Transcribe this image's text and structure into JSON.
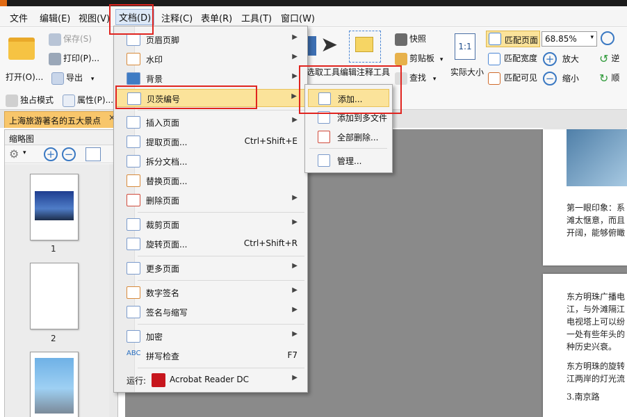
{
  "menubar": {
    "items": [
      "文件",
      "编辑(E)",
      "视图(V)",
      "文档(D)",
      "注释(C)",
      "表单(R)",
      "工具(T)",
      "窗口(W)"
    ]
  },
  "ribbon": {
    "open": "打开(O)...",
    "save": "保存(S)",
    "print": "打印(P)...",
    "export": "导出",
    "exclusive_mode": "独占模式",
    "properties": "属性(P)...",
    "select_tool": "选取工具",
    "edit_annotation_tool": "编辑注释工具",
    "snapshot": "快照",
    "clipboard": "剪贴板",
    "find": "查找",
    "actual_size": "实际大小",
    "fit_page": "匹配页面",
    "fit_width": "匹配宽度",
    "fit_visible": "匹配可见",
    "zoom_value": "68.85%",
    "zoom_in": "放大",
    "zoom_out": "缩小",
    "rotate_ccw": "逆",
    "rotate_cw": "顺"
  },
  "doc_tab": {
    "title": "上海旅游著名的五大景点",
    "close": "×"
  },
  "left_panel": {
    "title": "缩略图",
    "thumb_labels": [
      "1",
      "2"
    ]
  },
  "document_menu": {
    "items": [
      {
        "label": "页眉页脚",
        "shortcut": "",
        "submenu": true
      },
      {
        "label": "水印",
        "shortcut": "",
        "submenu": true
      },
      {
        "label": "背景",
        "shortcut": "",
        "submenu": true
      },
      {
        "label": "贝茨编号",
        "shortcut": "",
        "submenu": true
      },
      {
        "label": "插入页面",
        "shortcut": "",
        "submenu": true
      },
      {
        "label": "提取页面...",
        "shortcut": "Ctrl+Shift+E",
        "submenu": false
      },
      {
        "label": "拆分文档...",
        "shortcut": "",
        "submenu": false
      },
      {
        "label": "替换页面...",
        "shortcut": "",
        "submenu": false
      },
      {
        "label": "删除页面",
        "shortcut": "",
        "submenu": true
      },
      {
        "label": "裁剪页面",
        "shortcut": "",
        "submenu": true
      },
      {
        "label": "旋转页面...",
        "shortcut": "Ctrl+Shift+R",
        "submenu": false
      },
      {
        "label": "更多页面",
        "shortcut": "",
        "submenu": true
      },
      {
        "label": "数字签名",
        "shortcut": "",
        "submenu": true
      },
      {
        "label": "签名与缩写",
        "shortcut": "",
        "submenu": true
      },
      {
        "label": "加密",
        "shortcut": "",
        "submenu": true
      },
      {
        "label": "拼写检查",
        "shortcut": "F7",
        "submenu": false
      },
      {
        "label": "运行:",
        "app": "Acrobat Reader DC",
        "shortcut": "",
        "submenu": true
      }
    ]
  },
  "bates_submenu": {
    "items": [
      "添加...",
      "添加到多文件",
      "全部删除...",
      "管理..."
    ]
  },
  "doc_page": {
    "p1_lines": [
      "第一眼印象：系",
      "滩太惬意，而且",
      "开阔，能够俯瞰"
    ],
    "p2_lines": [
      "东方明珠广播电",
      "江，与外滩隔江",
      "电视塔上可以纷",
      "一处有些年头的",
      "种历史兴衰。",
      "东方明珠的旋转",
      "江两岸的灯光流",
      "3.南京路"
    ]
  },
  "colors": {
    "highlight": "#fbe39a",
    "annotation_red": "#e0241f",
    "tab_orange": "#f8c66b"
  }
}
